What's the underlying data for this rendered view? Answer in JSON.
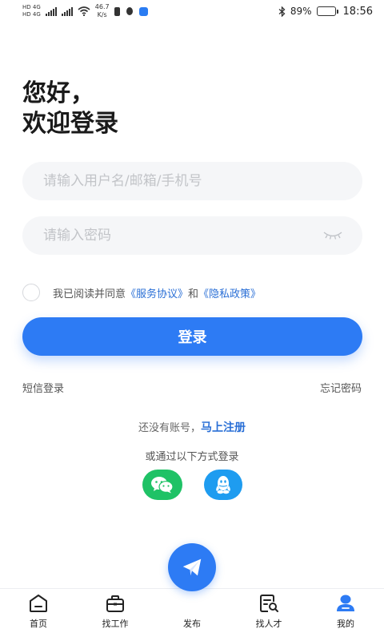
{
  "status_bar": {
    "sim1": "HD 4G",
    "sim2": "HD 4G",
    "speed_value": "46.7",
    "speed_unit": "K/s",
    "battery_percent": "89%",
    "battery_level": 0.89,
    "time": "18:56"
  },
  "greeting": {
    "line1": "您好，",
    "line2": "欢迎登录"
  },
  "form": {
    "username_placeholder": "请输入用户名/邮箱/手机号",
    "username_value": "",
    "password_placeholder": "请输入密码",
    "password_value": ""
  },
  "agreement": {
    "prefix": "我已阅读并同意",
    "service_link": "《服务协议》",
    "and": "和",
    "privacy_link": "《隐私政策》",
    "checked": false
  },
  "login_button": "登录",
  "links": {
    "sms_login": "短信登录",
    "forgot_password": "忘记密码"
  },
  "register": {
    "prompt": "还没有账号，",
    "link": "马上注册"
  },
  "other_login_label": "或通过以下方式登录",
  "social": [
    {
      "name": "wechat",
      "icon": "wechat-icon",
      "color": "#1fc266"
    },
    {
      "name": "qq",
      "icon": "qq-icon",
      "color": "#1e9cf0"
    }
  ],
  "bottom_nav": {
    "items": [
      {
        "label": "首页",
        "icon": "home-icon"
      },
      {
        "label": "找工作",
        "icon": "briefcase-icon"
      },
      {
        "label": "发布",
        "icon": "paper-plane-icon"
      },
      {
        "label": "找人才",
        "icon": "resume-search-icon"
      },
      {
        "label": "我的",
        "icon": "profile-icon"
      }
    ],
    "active": "我的"
  },
  "colors": {
    "accent": "#2d7bf4",
    "link": "#2a6fd6",
    "input_bg": "#f5f6f8"
  }
}
